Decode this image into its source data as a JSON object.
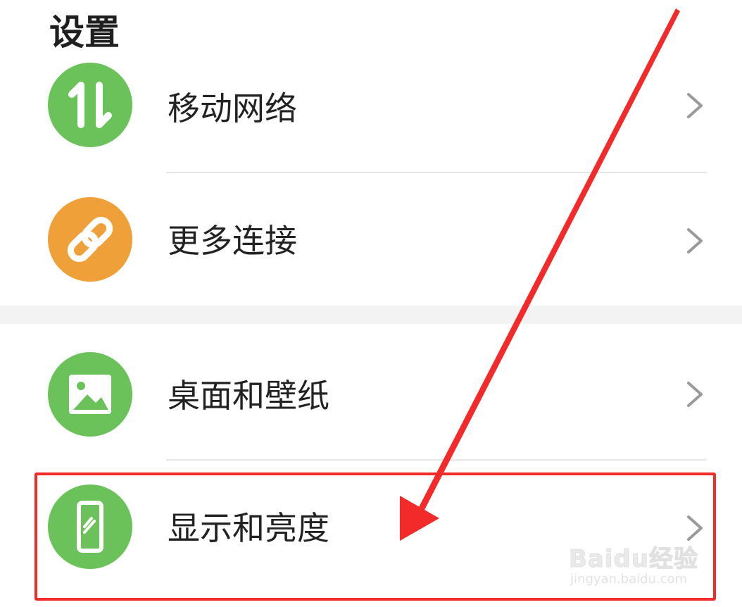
{
  "header": {
    "title": "设置"
  },
  "rows": [
    {
      "label": "移动网络",
      "icon": "mobile-data-icon",
      "color": "#6cc25a"
    },
    {
      "label": "更多连接",
      "icon": "link-icon",
      "color": "#f0a038"
    },
    {
      "label": "桌面和壁纸",
      "icon": "image-icon",
      "color": "#6cc25a"
    },
    {
      "label": "显示和亮度",
      "icon": "phone-display-icon",
      "color": "#6cc25a"
    }
  ],
  "annotation": {
    "color": "#f22a2a"
  },
  "watermark": {
    "brand": "Baidu经验",
    "url": "jingyan.baidu.com"
  }
}
